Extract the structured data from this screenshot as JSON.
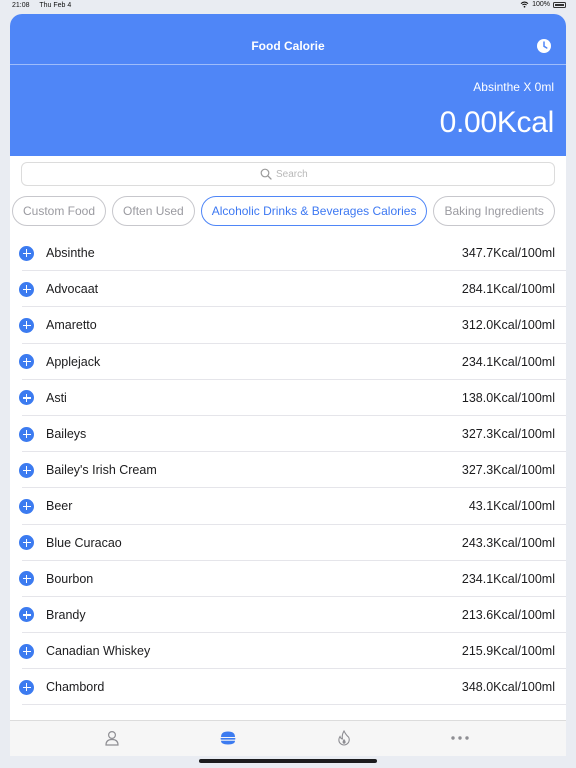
{
  "status_bar": {
    "time": "21:08",
    "date": "Thu Feb 4",
    "battery": "100%"
  },
  "header": {
    "title": "Food Calorie",
    "selected_food": "Absinthe X 0ml",
    "total_kcal": "0.00Kcal"
  },
  "search": {
    "placeholder": "Search"
  },
  "categories": [
    {
      "label": "Custom Food",
      "active": false
    },
    {
      "label": "Often Used",
      "active": false
    },
    {
      "label": "Alcoholic Drinks & Beverages Calories",
      "active": true
    },
    {
      "label": "Baking Ingredients",
      "active": false
    }
  ],
  "foods": [
    {
      "name": "Absinthe",
      "kcal": "347.7Kcal/100ml"
    },
    {
      "name": "Advocaat",
      "kcal": "284.1Kcal/100ml"
    },
    {
      "name": "Amaretto",
      "kcal": "312.0Kcal/100ml"
    },
    {
      "name": "Applejack",
      "kcal": "234.1Kcal/100ml"
    },
    {
      "name": "Asti",
      "kcal": "138.0Kcal/100ml"
    },
    {
      "name": "Baileys",
      "kcal": "327.3Kcal/100ml"
    },
    {
      "name": "Bailey's Irish Cream",
      "kcal": "327.3Kcal/100ml"
    },
    {
      "name": "Beer",
      "kcal": "43.1Kcal/100ml"
    },
    {
      "name": "Blue Curacao",
      "kcal": "243.3Kcal/100ml"
    },
    {
      "name": "Bourbon",
      "kcal": "234.1Kcal/100ml"
    },
    {
      "name": "Brandy",
      "kcal": "213.6Kcal/100ml"
    },
    {
      "name": "Canadian Whiskey",
      "kcal": "215.9Kcal/100ml"
    },
    {
      "name": "Chambord",
      "kcal": "348.0Kcal/100ml"
    }
  ],
  "tabs": [
    {
      "icon": "person-icon",
      "active": false
    },
    {
      "icon": "food-icon",
      "active": true
    },
    {
      "icon": "flame-icon",
      "active": false
    },
    {
      "icon": "more-icon",
      "active": false
    }
  ],
  "colors": {
    "accent": "#4f86f7",
    "add_button": "#3c7bf0",
    "inactive": "#9a9aa0"
  }
}
